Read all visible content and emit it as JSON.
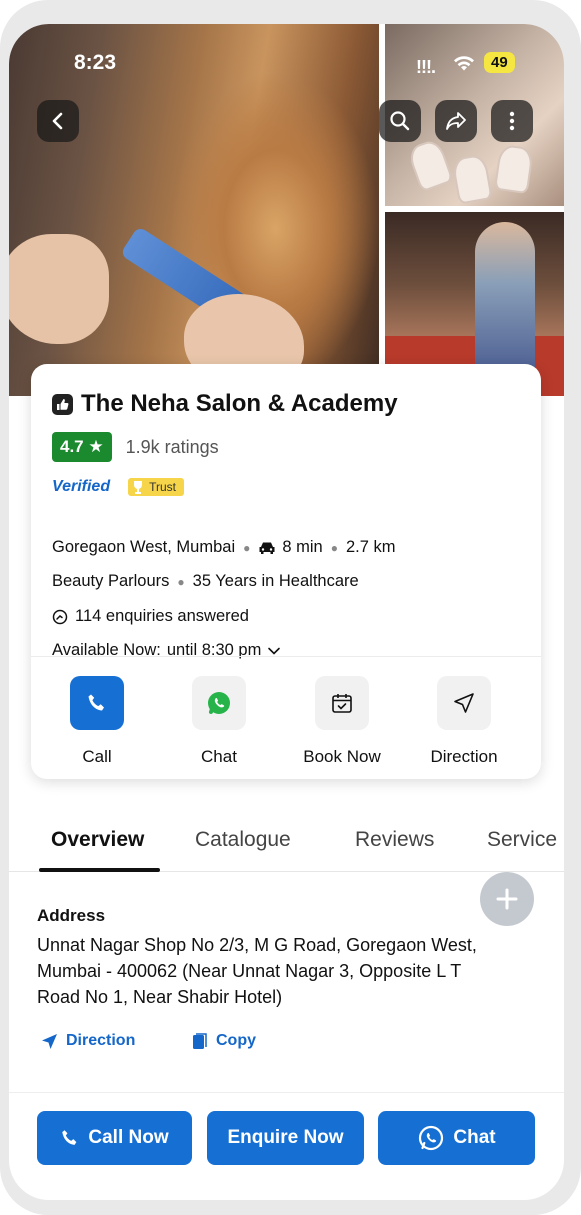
{
  "status_bar": {
    "time": "8:23",
    "signal": "!!!.",
    "battery": "49"
  },
  "business": {
    "name": "The Neha Salon & Academy",
    "rating": "4.7 ★",
    "ratings_count": "1.9k ratings",
    "verified_label": "Verified",
    "trust_label": "Trust",
    "location": "Goregaon West, Mumbai",
    "drive_time": "8 min",
    "distance": "2.7 km",
    "category": "Beauty Parlours",
    "experience": "35 Years in Healthcare",
    "enquiries": "114 enquiries answered",
    "availability_label": "Available Now:",
    "availability_value": "until 8:30 pm"
  },
  "actions": [
    {
      "label": "Call",
      "icon": "phone-icon"
    },
    {
      "label": "Chat",
      "icon": "whatsapp-icon"
    },
    {
      "label": "Book Now",
      "icon": "calendar-check-icon"
    },
    {
      "label": "Direction",
      "icon": "navigation-arrow-icon"
    }
  ],
  "tabs": [
    "Overview",
    "Catalogue",
    "Reviews",
    "Service"
  ],
  "active_tab": "Overview",
  "address": {
    "heading": "Address",
    "text": "Unnat Nagar Shop No 2/3, M G Road, Goregaon West, Mumbai - 400062 (Near Unnat Nagar 3, Opposite L T Road No 1, Near Shabir Hotel)",
    "direction_label": "Direction",
    "copy_label": "Copy"
  },
  "bottom_bar": {
    "call_label": "Call Now",
    "enquire_label": "Enquire Now",
    "chat_label": "Chat"
  },
  "colors": {
    "primary": "#1670d4",
    "rating_green": "#1b8a2e",
    "trust_yellow": "#f6d54a",
    "battery_yellow": "#f5e642"
  }
}
